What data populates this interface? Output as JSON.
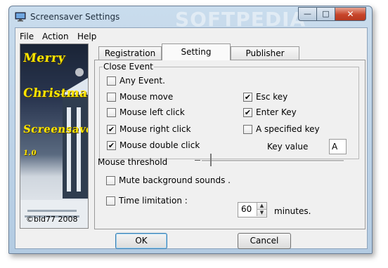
{
  "window": {
    "title": "Screensaver Settings",
    "watermark": "SOFTPEDIA",
    "minimize_glyph": "—",
    "maximize_glyph": "□",
    "close_glyph": "✕"
  },
  "menu": [
    "File",
    "Action",
    "Help"
  ],
  "banner": {
    "lines": [
      "Merry",
      "Christmas",
      "Screensaver",
      "1.0"
    ],
    "copyright": "©bld77 2008"
  },
  "tabs": [
    "Registration",
    "Setting",
    "Publisher"
  ],
  "active_tab": "Setting",
  "close_event": {
    "group_label": "Close Event",
    "left_options": [
      {
        "label": "Any Event.",
        "checked": false
      },
      {
        "label": "Mouse move",
        "checked": false
      },
      {
        "label": "Mouse left click",
        "checked": false
      },
      {
        "label": "Mouse right click",
        "checked": true
      },
      {
        "label": "Mouse double click",
        "checked": true
      }
    ],
    "right_options": [
      {
        "label": "Esc key",
        "checked": true
      },
      {
        "label": "Enter Key",
        "checked": true
      },
      {
        "label": "A specified key",
        "checked": false
      }
    ],
    "key_value_label": "Key value",
    "key_value": "A"
  },
  "mouse_threshold": {
    "label": "Mouse threshold",
    "value_fraction": 0.06
  },
  "mute_background": {
    "label": "Mute background sounds .",
    "checked": false
  },
  "time_limitation": {
    "label": "Time limitation :",
    "checked": false,
    "value": "60",
    "unit": "minutes."
  },
  "buttons": {
    "ok": "OK",
    "cancel": "Cancel"
  },
  "check_glyph": "✔"
}
